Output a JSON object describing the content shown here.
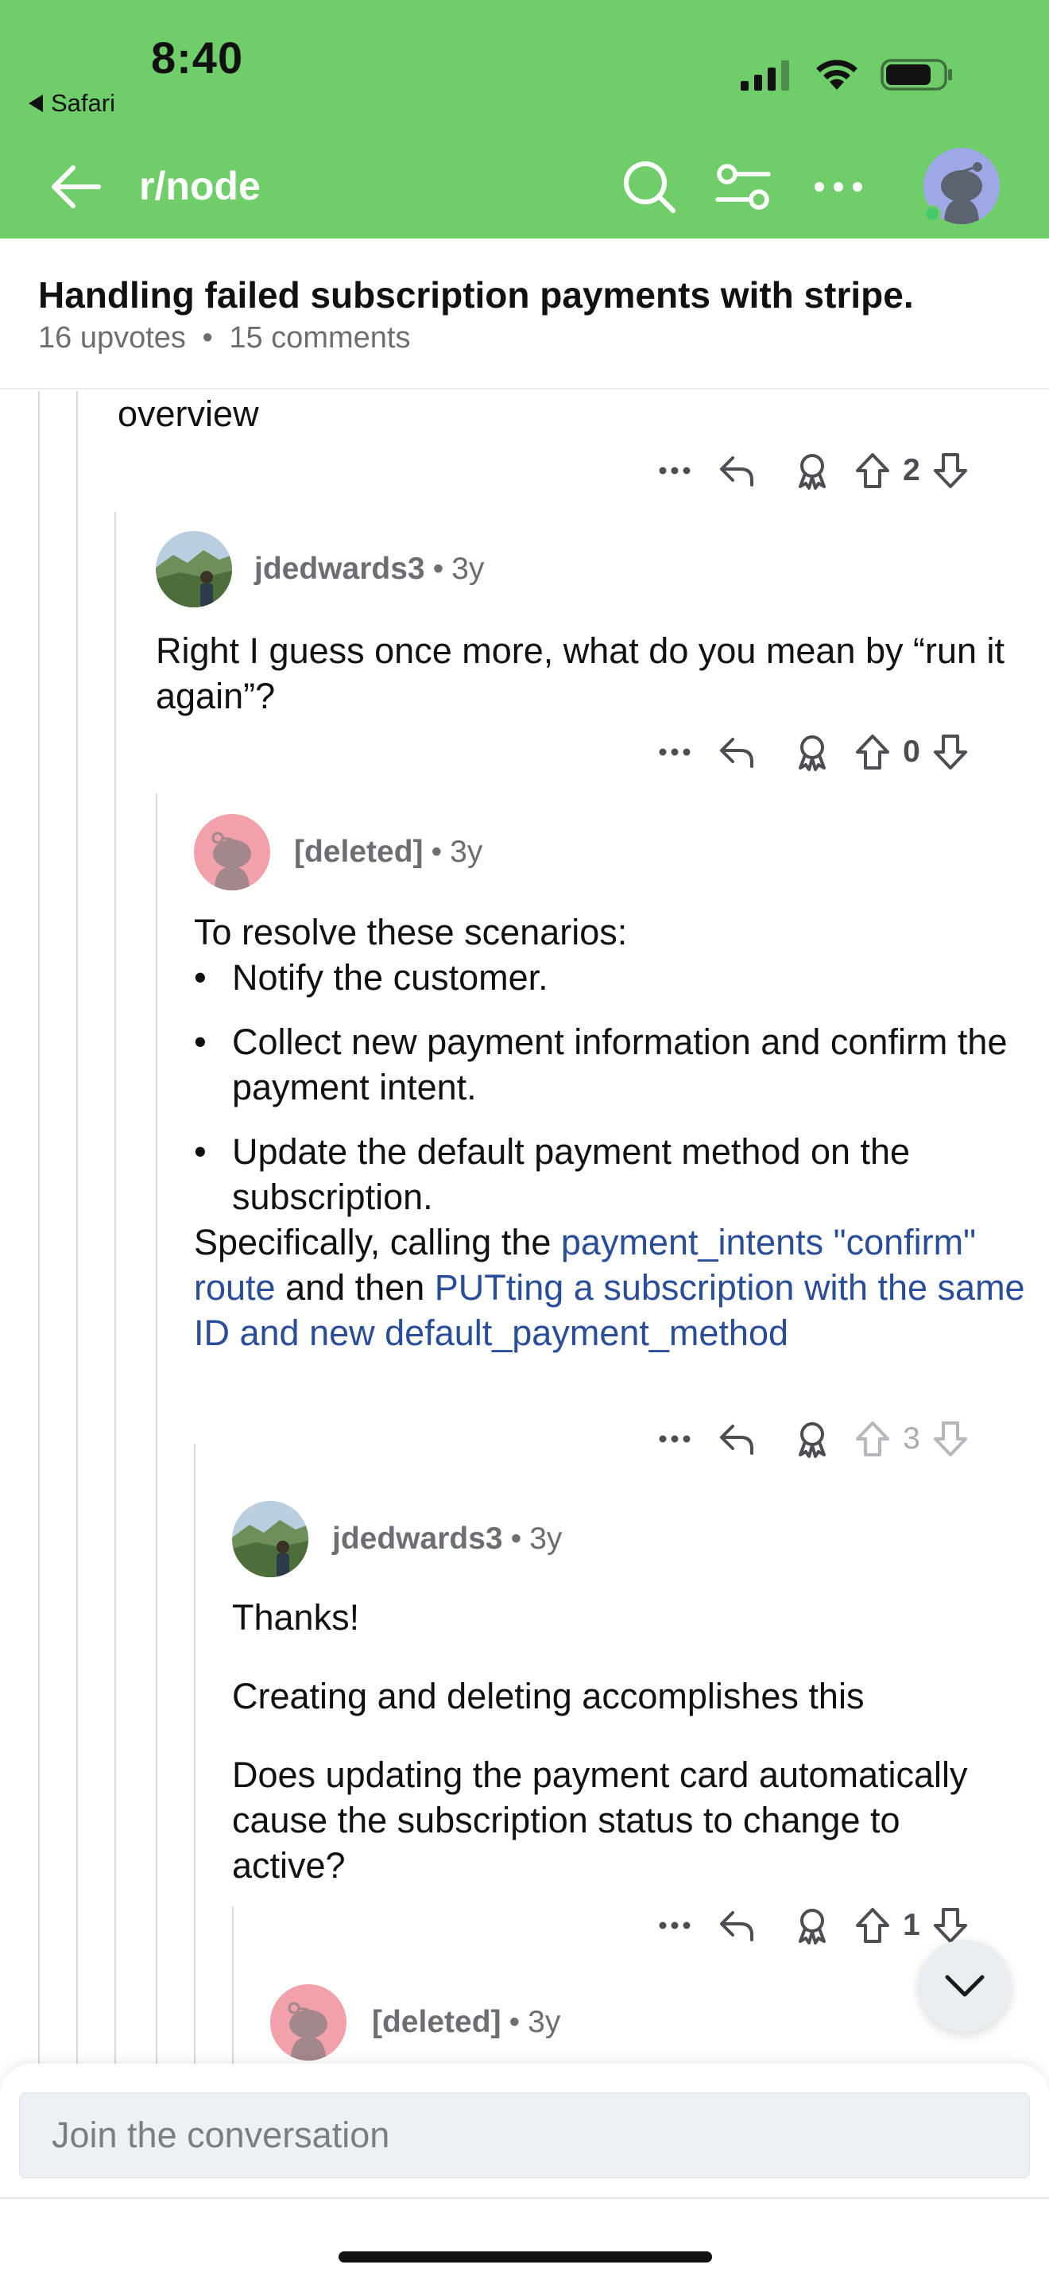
{
  "status_bar": {
    "time": "8:40",
    "back_app": "Safari"
  },
  "header": {
    "subreddit": "r/node"
  },
  "post": {
    "title": "Handling failed subscription payments with stripe.",
    "upvotes": "16 upvotes",
    "separator": "•",
    "comments": "15 comments"
  },
  "comments": [
    {
      "fragment_text": "overview",
      "votes": "2"
    },
    {
      "author": "jdedwards3",
      "age": "3y",
      "dot": "•",
      "body": "Right I guess once more, what do you mean by “run it again”?",
      "votes": "0"
    },
    {
      "author": "[deleted]",
      "age": "3y",
      "dot": "•",
      "intro": "To resolve these scenarios:",
      "bullets": [
        "Notify the customer.",
        "Collect new payment information and confirm the payment intent.",
        "Update the default payment method on the subscription."
      ],
      "after_a": "Specifically, calling the ",
      "link1": "payment_intents \"confirm\" route",
      "after_b": " and then ",
      "link2": "PUTting a subscription with the same ID and new default_payment_method",
      "votes": "3"
    },
    {
      "author": "jdedwards3",
      "age": "3y",
      "dot": "•",
      "paragraphs": [
        "Thanks!",
        "Creating and deleting accomplishes this",
        "Does updating the payment card automatically cause the subscription status to change to active?"
      ],
      "votes": "1"
    },
    {
      "author": "[deleted]",
      "age": "3y",
      "dot": "•"
    }
  ],
  "composer": {
    "placeholder": "Join the conversation"
  },
  "colors": {
    "header_bg": "#6fce6a",
    "link": "#2a4d9a",
    "muted": "#6b6f73"
  },
  "icons": [
    "back-arrow-icon",
    "search-icon",
    "filter-icon",
    "more-icon",
    "reply-icon",
    "award-icon",
    "upvote-icon",
    "downvote-icon",
    "chevron-down-icon"
  ]
}
